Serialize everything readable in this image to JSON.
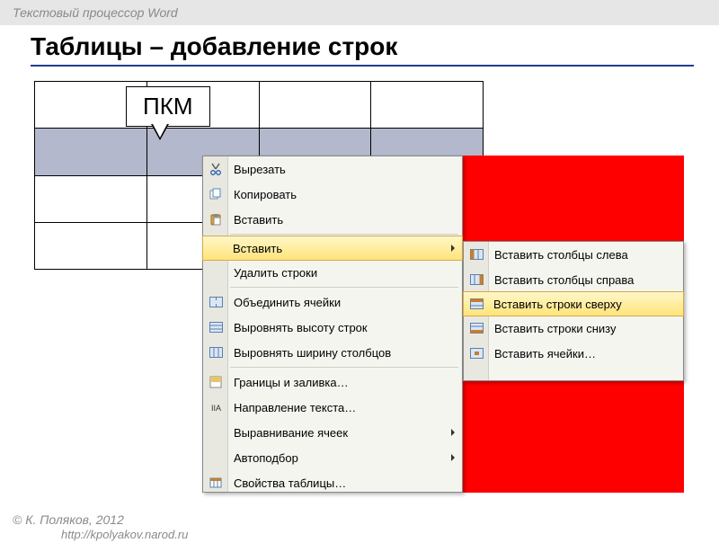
{
  "header": {
    "app_title": "Текстовый процессор Word"
  },
  "slide": {
    "title": "Таблицы – добавление строк",
    "callout": "ПКМ"
  },
  "menu": {
    "cut": "Вырезать",
    "copy": "Копировать",
    "paste": "Вставить",
    "insert": "Вставить",
    "delete_rows": "Удалить строки",
    "merge_cells": "Объединить ячейки",
    "distribute_rows": "Выровнять высоту строк",
    "distribute_cols": "Выровнять ширину столбцов",
    "borders": "Границы и заливка…",
    "text_direction": "Направление текста…",
    "cell_alignment": "Выравнивание ячеек",
    "autofit": "Автоподбор",
    "table_props": "Свойства таблицы…"
  },
  "submenu": {
    "cols_left": "Вставить столбцы слева",
    "cols_right": "Вставить столбцы справа",
    "rows_above": "Вставить строки сверху",
    "rows_below": "Вставить строки снизу",
    "cells": "Вставить ячейки…"
  },
  "footer": {
    "author": "© К. Поляков, 2012",
    "url": "http://kpolyakov.narod.ru"
  }
}
